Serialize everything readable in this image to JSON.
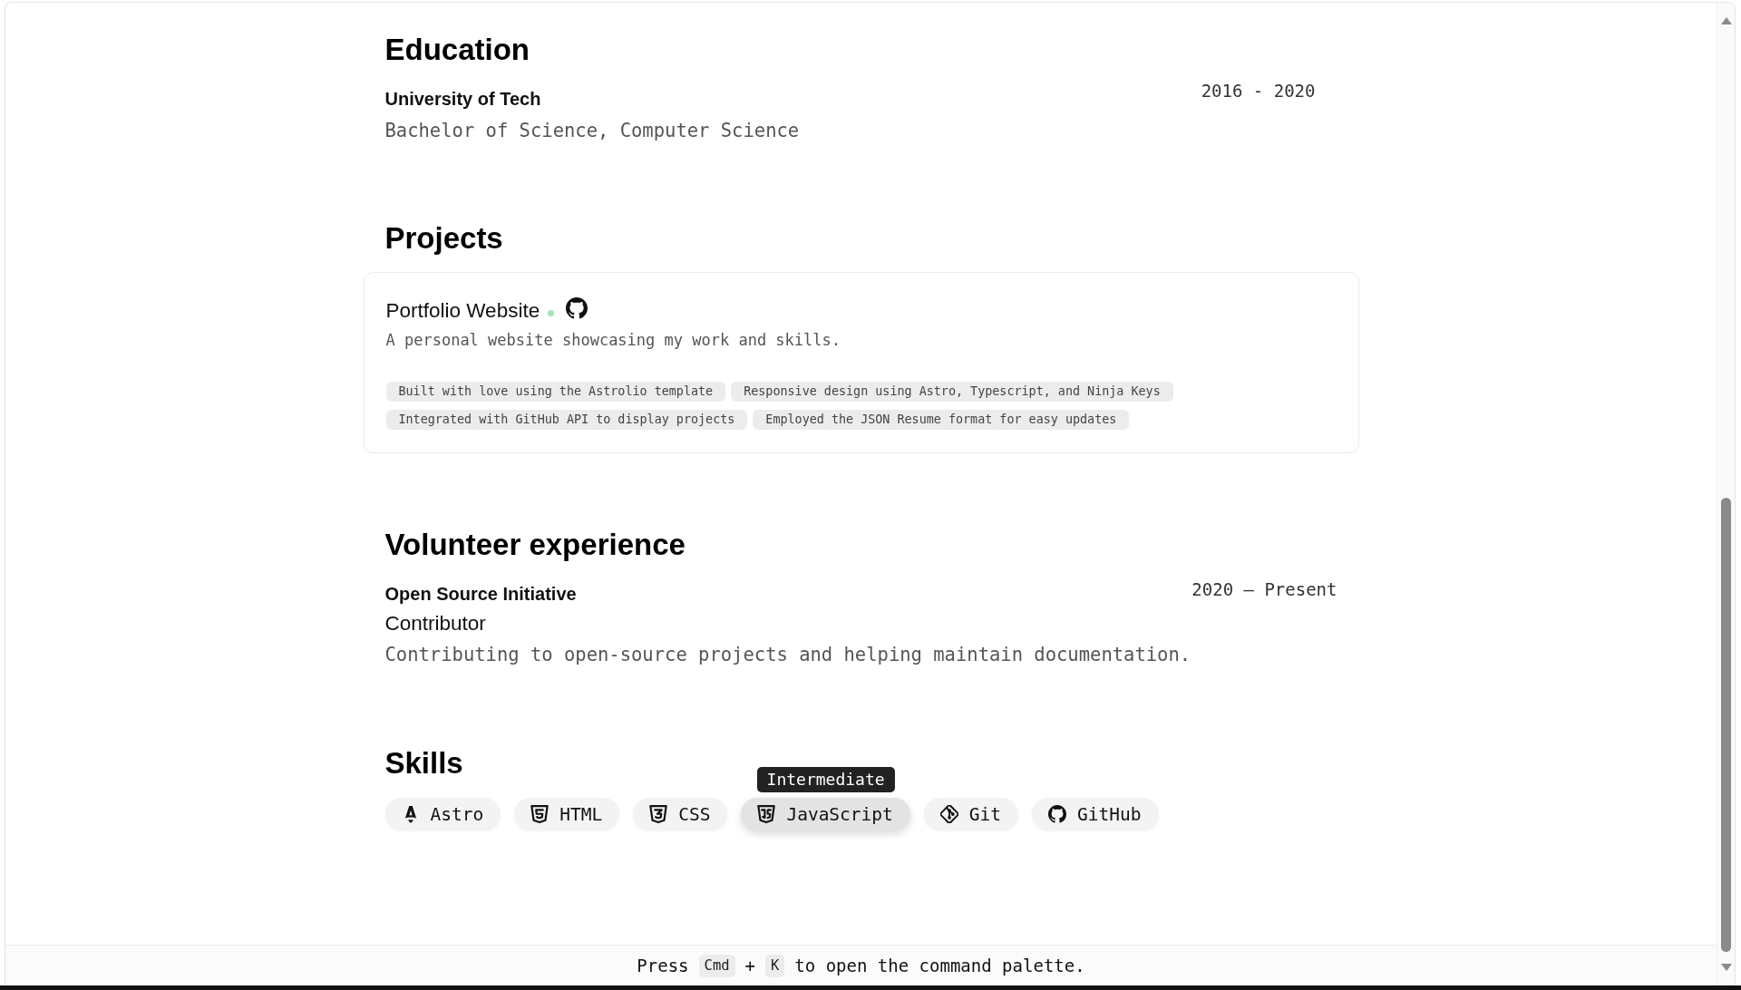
{
  "education": {
    "title": "Education",
    "entries": [
      {
        "institution": "University of Tech",
        "degree": "Bachelor of Science, Computer Science",
        "dates": "2016 - 2020"
      }
    ]
  },
  "projects": {
    "title": "Projects",
    "items": [
      {
        "name": "Portfolio Website",
        "description": "A personal website showcasing my work and skills.",
        "highlights": [
          "Built with love using the Astrolio template",
          "Responsive design using Astro, Typescript, and Ninja Keys",
          "Integrated with GitHub API to display projects",
          "Employed the JSON Resume format for easy updates"
        ]
      }
    ]
  },
  "volunteer": {
    "title": "Volunteer experience",
    "entries": [
      {
        "organization": "Open Source Initiative",
        "position": "Contributor",
        "dates": "2020 – Present",
        "summary": "Contributing to open-source projects and helping maintain documentation."
      }
    ]
  },
  "skills": {
    "title": "Skills",
    "items": [
      {
        "kind": "astro",
        "name": "Astro",
        "hovered": false
      },
      {
        "kind": "html",
        "name": "HTML",
        "hovered": false
      },
      {
        "kind": "css",
        "name": "CSS",
        "hovered": false
      },
      {
        "kind": "javascript",
        "name": "JavaScript",
        "hovered": true,
        "tooltip": "Intermediate"
      },
      {
        "kind": "git",
        "name": "Git",
        "hovered": false
      },
      {
        "kind": "github",
        "name": "GitHub",
        "hovered": false
      }
    ]
  },
  "command_hint": {
    "parts": [
      {
        "kind": "text",
        "text": "Press"
      },
      {
        "kind": "key",
        "text": "Cmd"
      },
      {
        "kind": "text",
        "text": "+"
      },
      {
        "kind": "key",
        "text": "K"
      },
      {
        "kind": "text",
        "text": "to open the command palette."
      }
    ]
  }
}
